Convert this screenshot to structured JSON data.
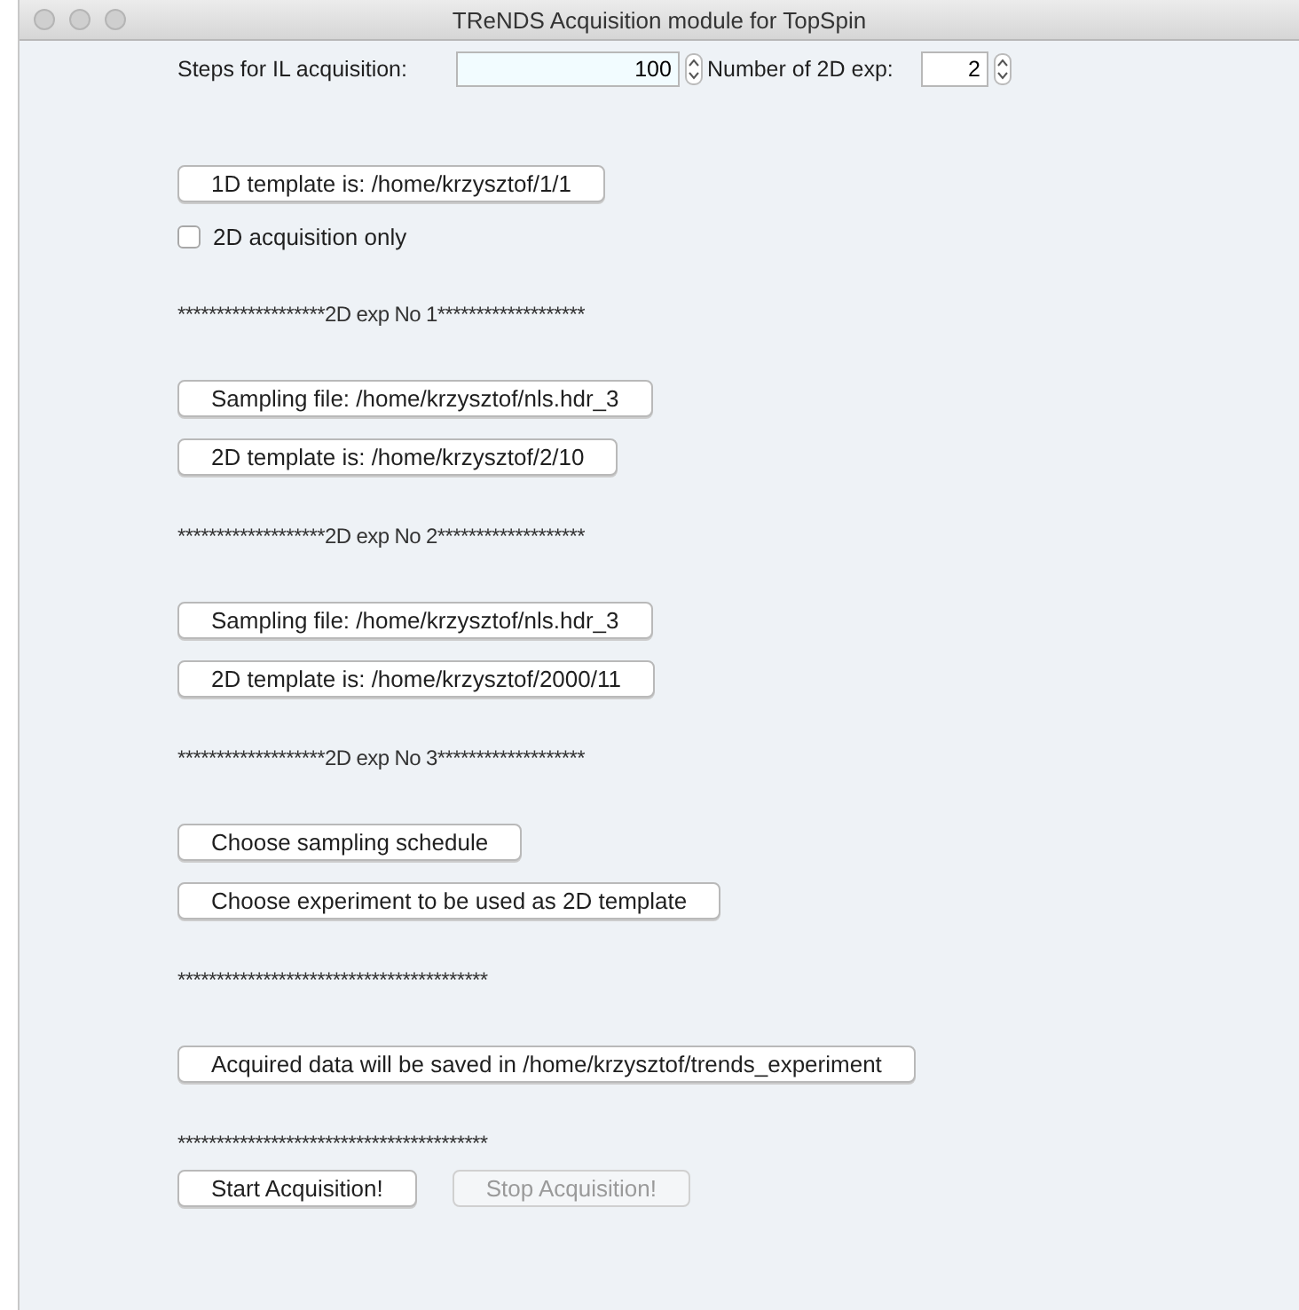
{
  "window": {
    "title": "TReNDS  Acquisition module for TopSpin"
  },
  "settings": [
    {
      "label": "Steps for IL acquisition:",
      "value": "100"
    },
    {
      "label": "Number of 2D exp:",
      "value": "2"
    }
  ],
  "items": [
    {
      "kind": "button",
      "label": "1D template is: /home/krzysztof/1/1"
    },
    {
      "kind": "checkbox",
      "label": "2D acquisition only",
      "checked": false
    },
    {
      "kind": "separator",
      "text": "*******************2D exp No 1*******************"
    },
    {
      "kind": "button",
      "label": "Sampling  file: /home/krzysztof/nls.hdr_3"
    },
    {
      "kind": "button",
      "label": "2D template is: /home/krzysztof/2/10"
    },
    {
      "kind": "separator",
      "text": "*******************2D exp No 2*******************"
    },
    {
      "kind": "button",
      "label": "Sampling  file: /home/krzysztof/nls.hdr_3"
    },
    {
      "kind": "button",
      "label": "2D template is: /home/krzysztof/2000/11"
    },
    {
      "kind": "separator",
      "text": "*******************2D exp No 3*******************"
    },
    {
      "kind": "button",
      "label": "Choose sampling schedule"
    },
    {
      "kind": "button",
      "label": "Choose experiment to be used as 2D template"
    },
    {
      "kind": "separator",
      "text": "****************************************"
    },
    {
      "kind": "button",
      "label": "Acquired data will be saved in /home/krzysztof/trends_experiment"
    },
    {
      "kind": "separator",
      "text": "****************************************"
    }
  ],
  "actions": [
    {
      "label": "Start Acquisition!",
      "disabled": false
    },
    {
      "label": "Stop Acquisition!",
      "disabled": true
    }
  ]
}
